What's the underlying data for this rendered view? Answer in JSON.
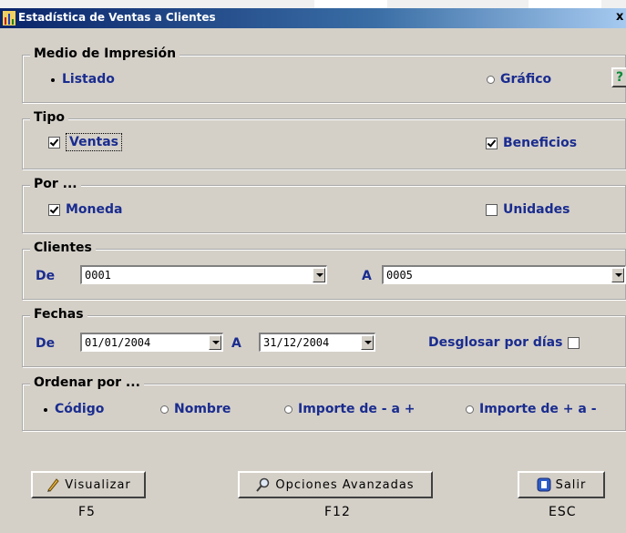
{
  "window": {
    "title": "Estadística de Ventas a Clientes"
  },
  "medio": {
    "legend": "Medio de Impresión",
    "listado": "Listado",
    "grafico": "Gráfico",
    "selected": "Listado"
  },
  "tipo": {
    "legend": "Tipo",
    "ventas": {
      "label": "Ventas",
      "checked": true
    },
    "beneficios": {
      "label": "Beneficios",
      "checked": true
    }
  },
  "por": {
    "legend": "Por ...",
    "moneda": {
      "label": "Moneda",
      "checked": true
    },
    "unidades": {
      "label": "Unidades",
      "checked": false
    }
  },
  "clientes": {
    "legend": "Clientes",
    "de_label": "De",
    "de_value": "0001",
    "a_label": "A",
    "a_value": "0005"
  },
  "fechas": {
    "legend": "Fechas",
    "de_label": "De",
    "de_value": "01/01/2004",
    "a_label": "A",
    "a_value": "31/12/2004",
    "desglosar_label": "Desglosar por días",
    "desglosar_checked": false
  },
  "ordenar": {
    "legend": "Ordenar por ...",
    "codigo": "Código",
    "nombre": "Nombre",
    "importe_asc": "Importe de - a +",
    "importe_desc": "Importe de + a -",
    "selected": "Código"
  },
  "buttons": {
    "visualizar": {
      "label": "Visualizar",
      "key": "F5"
    },
    "opciones": {
      "label": "Opciones Avanzadas",
      "key": "F12"
    },
    "salir": {
      "label": "Salir",
      "key": "ESC"
    }
  },
  "icons": {
    "app": "chart-icon",
    "help": "help-icon",
    "visualizar": "pen-icon",
    "opciones": "search-icon",
    "salir": "exit-icon"
  },
  "colors": {
    "label_blue": "#1a2c8f",
    "title_bar": "#0a246a",
    "dialog_bg": "#d4d0c8"
  }
}
